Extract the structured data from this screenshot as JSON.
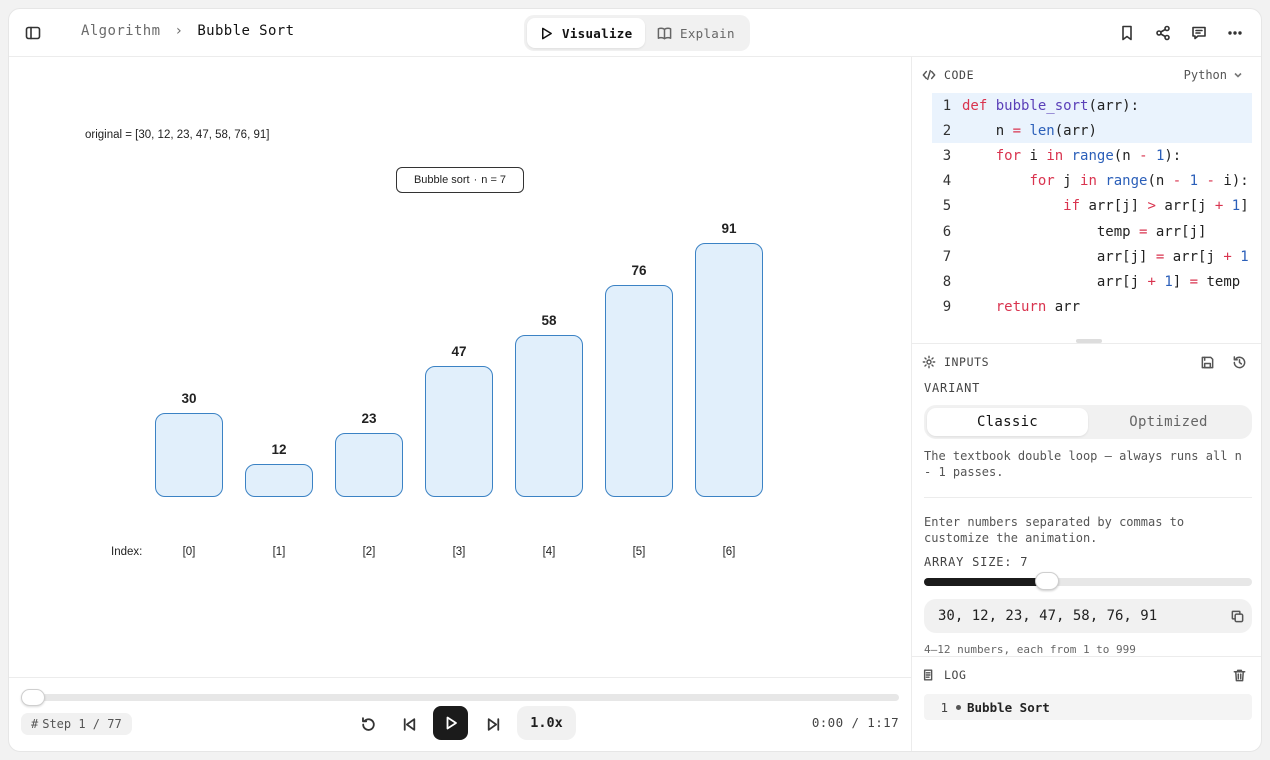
{
  "header": {
    "breadcrumb": [
      "Algorithm",
      "Bubble Sort"
    ],
    "modes": [
      "Visualize",
      "Explain"
    ],
    "active_mode": "Visualize"
  },
  "canvas": {
    "original_label": "original = [30, 12, 23, 47, 58, 76, 91]",
    "tag_title": "Bubble sort",
    "tag_dot": "·",
    "tag_n": "n = 7",
    "index_label": "Index:",
    "bars": [
      {
        "value": "30",
        "index": "[0]"
      },
      {
        "value": "12",
        "index": "[1]"
      },
      {
        "value": "23",
        "index": "[2]"
      },
      {
        "value": "47",
        "index": "[3]"
      },
      {
        "value": "58",
        "index": "[4]"
      },
      {
        "value": "76",
        "index": "[5]"
      },
      {
        "value": "91",
        "index": "[6]"
      }
    ],
    "bar_color": "#e1effb",
    "bar_border_color": "#3b82c4"
  },
  "player": {
    "step_icon": "#",
    "step_text": "Step 1 / 77",
    "speed": "1.0x",
    "time": "0:00 / 1:17",
    "progress": 0
  },
  "code": {
    "heading": "CODE",
    "language": "Python",
    "highlighted_lines": [
      1,
      2
    ],
    "lines": [
      {
        "n": "1",
        "tokens": [
          [
            "kw",
            "def "
          ],
          [
            "fn",
            "bubble_sort"
          ],
          [
            "",
            "(arr):"
          ]
        ]
      },
      {
        "n": "2",
        "tokens": [
          [
            "",
            "    n "
          ],
          [
            "kw",
            "="
          ],
          [
            "",
            " "
          ],
          [
            "bi",
            "len"
          ],
          [
            "",
            "(arr)"
          ]
        ]
      },
      {
        "n": "3",
        "tokens": [
          [
            "",
            "    "
          ],
          [
            "kw",
            "for"
          ],
          [
            "",
            " i "
          ],
          [
            "kw",
            "in"
          ],
          [
            "",
            " "
          ],
          [
            "bi",
            "range"
          ],
          [
            "",
            "(n "
          ],
          [
            "kw",
            "-"
          ],
          [
            "",
            " "
          ],
          [
            "nm",
            "1"
          ],
          [
            "",
            "):"
          ]
        ]
      },
      {
        "n": "4",
        "tokens": [
          [
            "",
            "        "
          ],
          [
            "kw",
            "for"
          ],
          [
            "",
            " j "
          ],
          [
            "kw",
            "in"
          ],
          [
            "",
            " "
          ],
          [
            "bi",
            "range"
          ],
          [
            "",
            "(n "
          ],
          [
            "kw",
            "-"
          ],
          [
            "",
            " "
          ],
          [
            "nm",
            "1"
          ],
          [
            "",
            " "
          ],
          [
            "kw",
            "-"
          ],
          [
            "",
            " i):"
          ]
        ]
      },
      {
        "n": "5",
        "tokens": [
          [
            "",
            "            "
          ],
          [
            "kw",
            "if"
          ],
          [
            "",
            " arr[j] "
          ],
          [
            "kw",
            ">"
          ],
          [
            "",
            " arr[j "
          ],
          [
            "kw",
            "+"
          ],
          [
            "",
            " "
          ],
          [
            "nm",
            "1"
          ],
          [
            "",
            "]"
          ]
        ]
      },
      {
        "n": "6",
        "tokens": [
          [
            "",
            "                temp "
          ],
          [
            "kw",
            "="
          ],
          [
            "",
            " arr[j]"
          ]
        ]
      },
      {
        "n": "7",
        "tokens": [
          [
            "",
            "                arr[j] "
          ],
          [
            "kw",
            "="
          ],
          [
            "",
            " arr[j "
          ],
          [
            "kw",
            "+"
          ],
          [
            "",
            " "
          ],
          [
            "nm",
            "1"
          ]
        ]
      },
      {
        "n": "8",
        "tokens": [
          [
            "",
            "                arr[j "
          ],
          [
            "kw",
            "+"
          ],
          [
            "",
            " "
          ],
          [
            "nm",
            "1"
          ],
          [
            "",
            "] "
          ],
          [
            "kw",
            "="
          ],
          [
            "",
            " temp"
          ]
        ]
      },
      {
        "n": "9",
        "tokens": [
          [
            "",
            "    "
          ],
          [
            "kw",
            "return"
          ],
          [
            "",
            " arr"
          ]
        ]
      }
    ]
  },
  "inputs": {
    "heading": "INPUTS",
    "variant_label": "VARIANT",
    "variants": [
      "Classic",
      "Optimized"
    ],
    "active_variant": "Classic",
    "variant_description": "The textbook double loop — always runs all n - 1 passes.",
    "help_text": "Enter numbers separated by commas to customize the animation.",
    "array_size_label": "ARRAY SIZE: 7",
    "array_size": 7,
    "array_size_min": 4,
    "array_size_max": 12,
    "array_value": "30, 12, 23, 47, 58, 76, 91",
    "hint": "4–12 numbers, each from 1 to 999"
  },
  "log": {
    "heading": "LOG",
    "entries": [
      {
        "n": "1",
        "text": "Bubble Sort"
      }
    ]
  }
}
